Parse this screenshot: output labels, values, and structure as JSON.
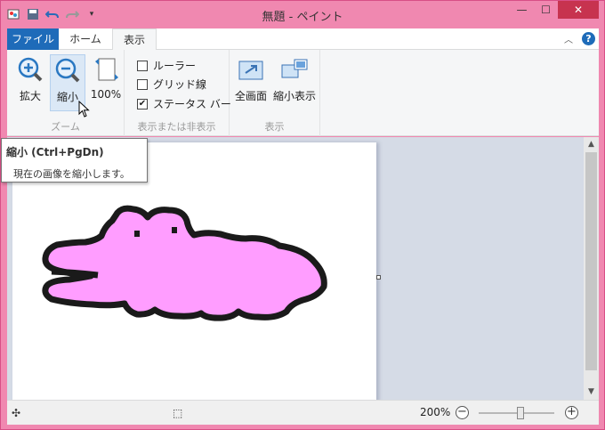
{
  "window": {
    "title": "無題 - ペイント"
  },
  "tabs": {
    "file": "ファイル",
    "home": "ホーム",
    "view": "表示"
  },
  "ribbon": {
    "zoom_group": {
      "label": "ズーム",
      "zoom_in": "拡大",
      "zoom_out": "縮小",
      "hundred": "100%"
    },
    "showhide_group": {
      "label": "表示または非表示",
      "ruler": "ルーラー",
      "gridlines": "グリッド線",
      "statusbar": "ステータス バー",
      "ruler_checked": false,
      "gridlines_checked": false,
      "statusbar_checked": true
    },
    "display_group": {
      "label": "表示",
      "fullscreen": "全画面",
      "thumbnail": "縮小表示"
    }
  },
  "tooltip": {
    "title": "縮小 (Ctrl+PgDn)",
    "description": "現在の画像を縮小します。"
  },
  "statusbar": {
    "zoom": "200%",
    "zoom_slider_fraction": 0.55
  },
  "colors": {
    "accent": "#1e6bb9",
    "window_frame": "#f088b0",
    "drawing_fill": "#ff9dff"
  }
}
